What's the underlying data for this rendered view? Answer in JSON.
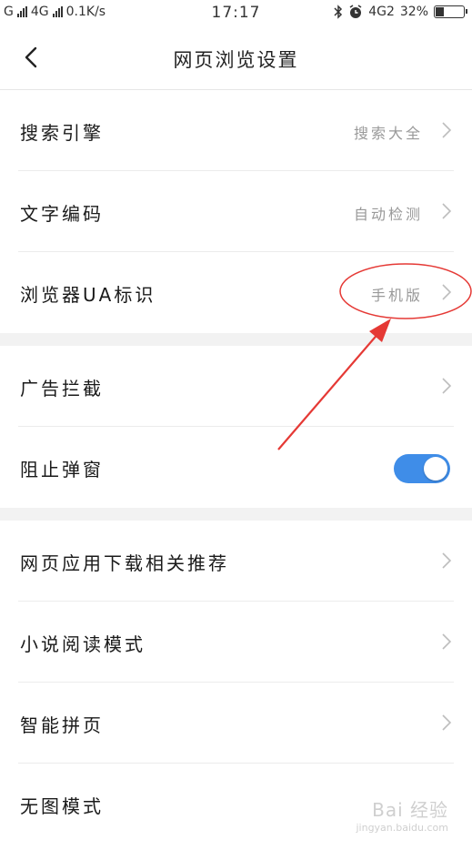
{
  "status_bar": {
    "carrier1": "G",
    "carrier2": "4G",
    "speed": "0.1K/s",
    "time": "17:17",
    "network": "4G2",
    "battery": "32%",
    "battery_level": 0.32
  },
  "nav": {
    "title": "网页浏览设置"
  },
  "group1": [
    {
      "label": "搜索引擎",
      "value": "搜索大全"
    },
    {
      "label": "文字编码",
      "value": "自动检测"
    },
    {
      "label": "浏览器UA标识",
      "value": "手机版"
    }
  ],
  "group2": [
    {
      "label": "广告拦截"
    },
    {
      "label": "阻止弹窗",
      "toggle": "on"
    }
  ],
  "group3": [
    {
      "label": "网页应用下载相关推荐"
    },
    {
      "label": "小说阅读模式"
    },
    {
      "label": "智能拼页"
    },
    {
      "label": "无图模式"
    }
  ],
  "colors": {
    "toggle_on": "#3f8de8",
    "annotation": "#e53935",
    "separator": "#f2f2f2"
  },
  "watermark": {
    "line1": "Bai 经验",
    "line2": "jingyan.baidu.com"
  }
}
